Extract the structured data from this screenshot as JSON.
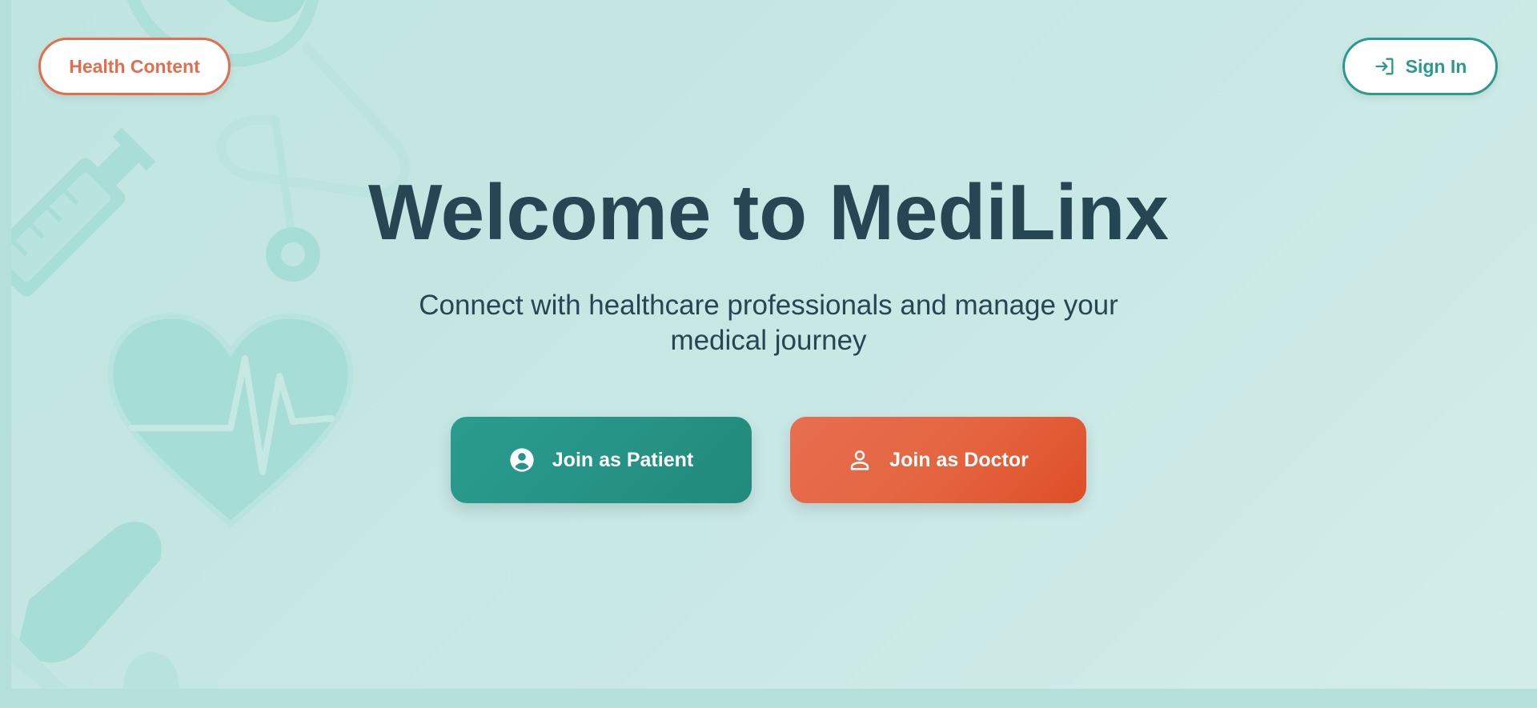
{
  "header": {
    "health_content_label": "Health Content",
    "sign_in_label": "Sign In",
    "sign_in_icon": "login-icon"
  },
  "hero": {
    "title": "Welcome to MediLinx",
    "subtitle": "Connect with healthcare professionals and manage your medical journey"
  },
  "actions": {
    "patient": {
      "label": "Join as Patient",
      "icon": "account-circle-icon"
    },
    "doctor": {
      "label": "Join as Doctor",
      "icon": "person-outline-icon"
    }
  },
  "background_icons": [
    "stethoscope-icon",
    "syringe-icon",
    "heart-pulse-icon",
    "pill-icon"
  ],
  "colors": {
    "primary": "#2a9d8f",
    "accent": "#e76f51",
    "text": "#264653",
    "background": "#c3e6e2"
  }
}
